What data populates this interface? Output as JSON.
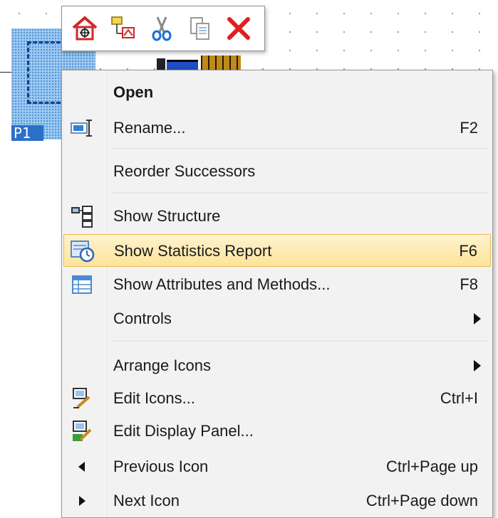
{
  "canvas": {
    "p1_label": "P1"
  },
  "toolbar": {
    "buttons": [
      {
        "icon": "home-network-icon"
      },
      {
        "icon": "object-tree-icon"
      },
      {
        "icon": "cut-icon"
      },
      {
        "icon": "copy-icon"
      },
      {
        "icon": "delete-icon"
      }
    ]
  },
  "menu": {
    "items": [
      {
        "label": "Open",
        "shortcut": "",
        "icon": ""
      },
      {
        "label": "Rename...",
        "shortcut": "F2",
        "icon": "rename-icon"
      },
      {
        "label": "Reorder Successors",
        "shortcut": "",
        "icon": ""
      },
      {
        "label": "Show Structure",
        "shortcut": "",
        "icon": "structure-icon"
      },
      {
        "label": "Show Statistics Report",
        "shortcut": "F6",
        "icon": "statistics-report-icon"
      },
      {
        "label": "Show Attributes and Methods...",
        "shortcut": "F8",
        "icon": "attributes-table-icon"
      },
      {
        "label": "Controls",
        "shortcut": "",
        "icon": ""
      },
      {
        "label": "Arrange Icons",
        "shortcut": "",
        "icon": ""
      },
      {
        "label": "Edit Icons...",
        "shortcut": "Ctrl+I",
        "icon": "edit-icons-icon"
      },
      {
        "label": "Edit Display Panel...",
        "shortcut": "",
        "icon": "edit-display-panel-icon"
      },
      {
        "label": "Previous Icon",
        "shortcut": "Ctrl+Page up",
        "icon": "triangle-left-icon"
      },
      {
        "label": "Next Icon",
        "shortcut": "Ctrl+Page down",
        "icon": "triangle-right-icon"
      }
    ],
    "highlighted_item": "Show Statistics Report",
    "colors": {
      "highlight": "#fde39a",
      "highlight_border": "#e9bb54",
      "background": "#f2f2f2"
    }
  }
}
